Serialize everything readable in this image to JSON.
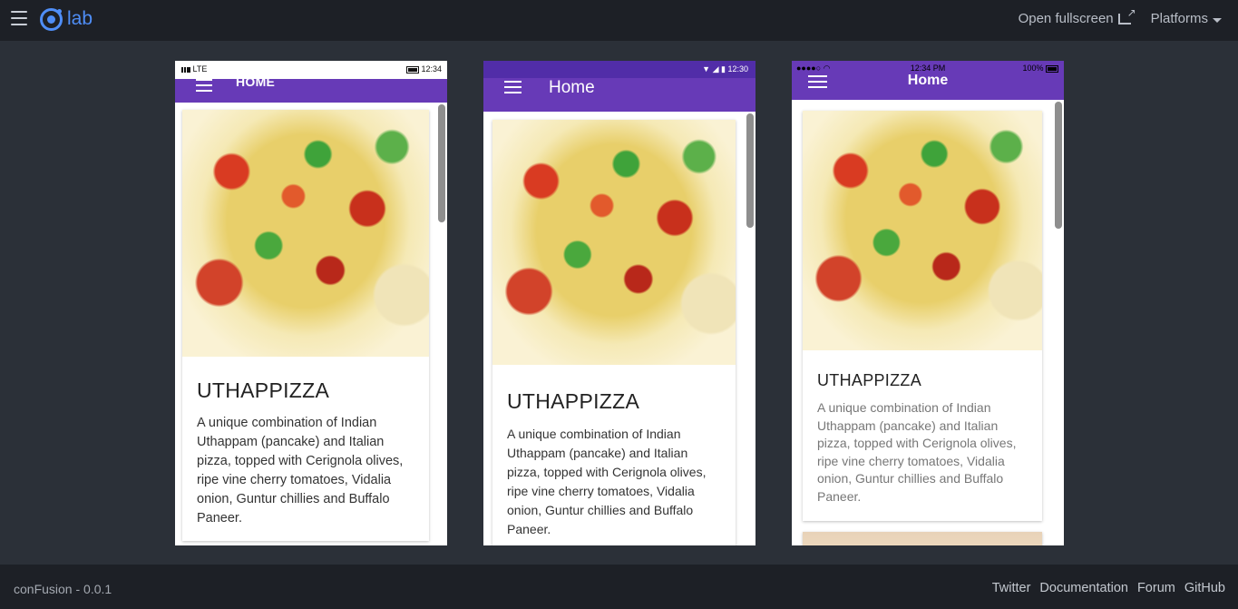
{
  "header": {
    "logo_text": "lab",
    "open_fullscreen": "Open fullscreen",
    "platforms": "Platforms"
  },
  "footer": {
    "version": "conFusion - 0.0.1",
    "links": [
      "Twitter",
      "Documentation",
      "Forum",
      "GitHub"
    ]
  },
  "devices": [
    {
      "status_left": "LTE",
      "status_time": "12:34",
      "toolbar_title": "Home",
      "card": {
        "title": "UTHAPPIZZA",
        "description": "A unique combination of Indian Uthappam (pancake) and Italian pizza, topped with Cerignola olives, ripe vine cherry tomatoes, Vidalia onion, Guntur chillies and Buffalo Paneer."
      }
    },
    {
      "status_time": "12:30",
      "toolbar_title": "Home",
      "card": {
        "title": "UTHAPPIZZA",
        "description": "A unique combination of Indian Uthappam (pancake) and Italian pizza, topped with Cerignola olives, ripe vine cherry tomatoes, Vidalia onion, Guntur chillies and Buffalo Paneer."
      }
    },
    {
      "status_time": "12:34 PM",
      "status_battery": "100%",
      "toolbar_title": "Home",
      "card": {
        "title": "UTHAPPIZZA",
        "description": "A unique combination of Indian Uthappam (pancake) and Italian pizza, topped with Cerignola olives, ripe vine cherry tomatoes, Vidalia onion, Guntur chillies and Buffalo Paneer."
      }
    }
  ],
  "colors": {
    "primary": "#673ab7",
    "primary_dark": "#512da8",
    "ionic_blue": "#4f8ef7",
    "chrome_bg": "#1d2026",
    "stage_bg": "#2b3038"
  }
}
